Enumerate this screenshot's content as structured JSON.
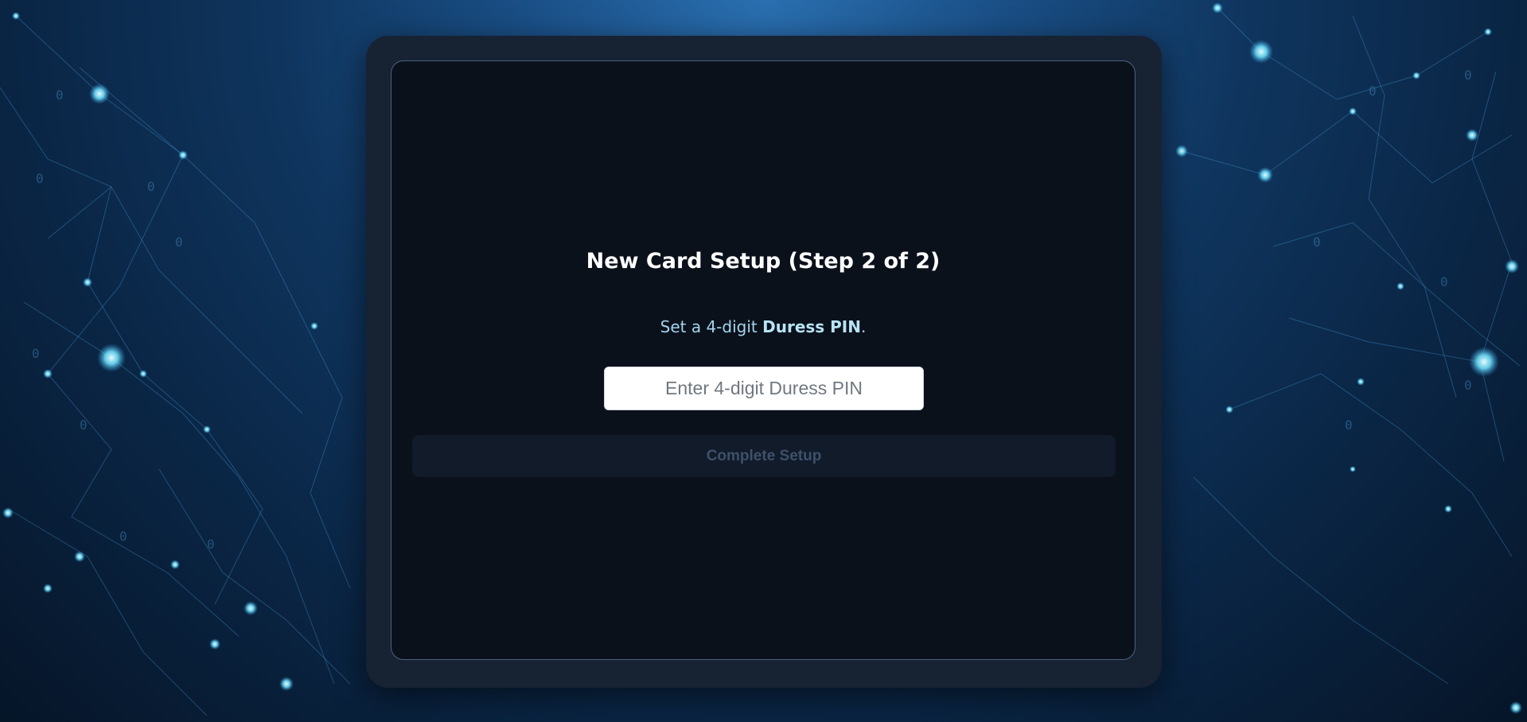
{
  "setup": {
    "title": "New Card Setup (Step 2 of 2)",
    "instruction_prefix": "Set a 4-digit ",
    "instruction_emphasis": "Duress PIN",
    "instruction_suffix": ".",
    "pin_placeholder": "Enter 4-digit Duress PIN",
    "pin_value": "",
    "complete_button_label": "Complete Setup",
    "complete_button_enabled": false
  },
  "colors": {
    "background": "#0f355e",
    "device_frame": "#172233",
    "screen": "#0b111b",
    "screen_border": "#4b6382",
    "title_text": "#ffffff",
    "instruction_text": "#a5d4ec",
    "button_disabled_bg": "#111b2a",
    "button_disabled_text": "#3e506a",
    "network_glow": "#5fd8f5"
  }
}
